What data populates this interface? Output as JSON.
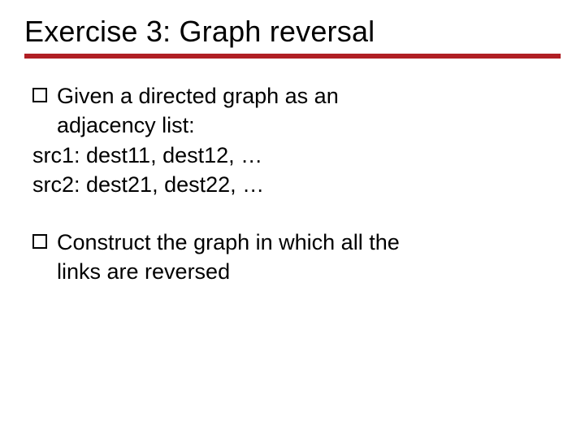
{
  "title": "Exercise 3: Graph reversal",
  "bullet1": {
    "line1": "Given a directed graph as an",
    "line2": "adjacency list:"
  },
  "lines": {
    "l1": "src1: dest11, dest12, …",
    "l2": "src2: dest21, dest22, …"
  },
  "bullet2": {
    "line1": "Construct the graph in which all the",
    "line2": "links are reversed"
  }
}
